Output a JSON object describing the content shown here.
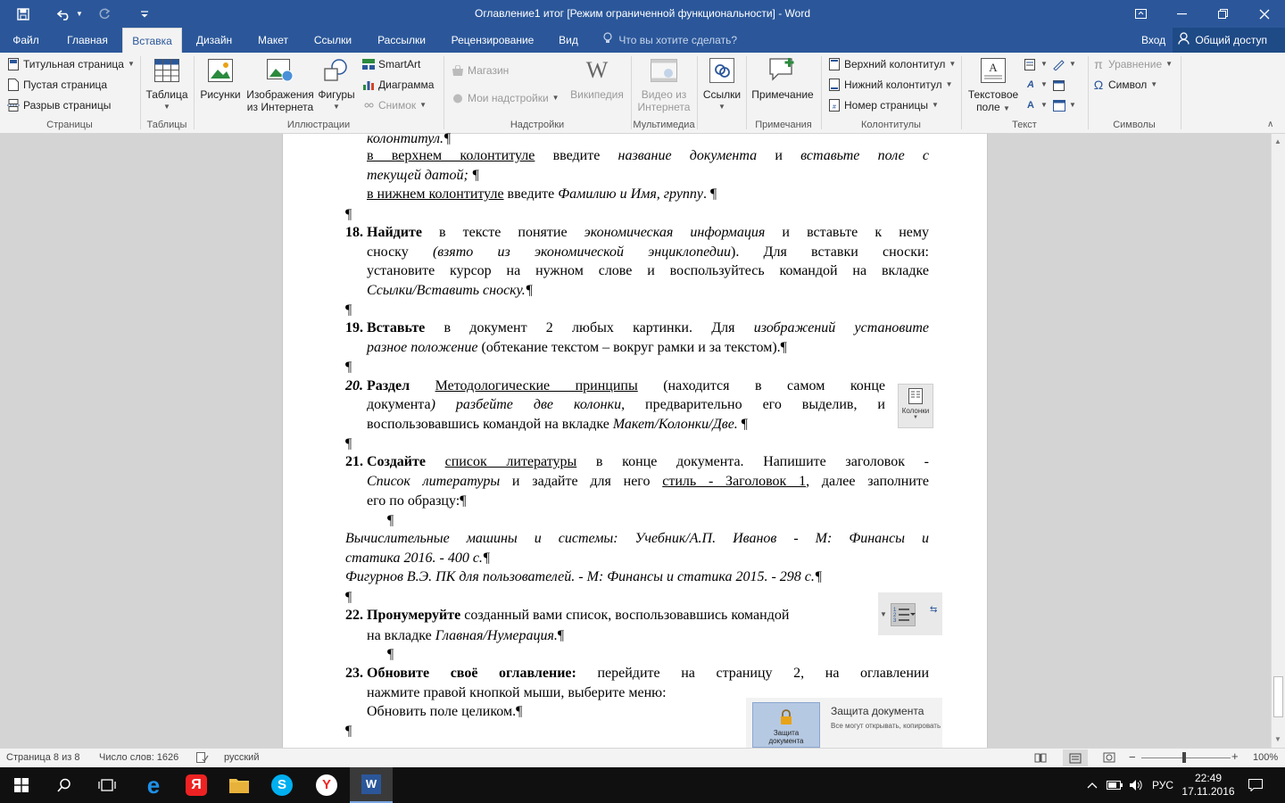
{
  "window": {
    "title": "Оглавление1 итог [Режим ограниченной функциональности] - Word"
  },
  "quick_access": {
    "save_icon": "save-icon",
    "undo_icon": "undo-icon",
    "redo_icon": "redo-icon",
    "customize_icon": "customize-qat-icon"
  },
  "tabs": [
    "Файл",
    "Главная",
    "Вставка",
    "Дизайн",
    "Макет",
    "Ссылки",
    "Рассылки",
    "Рецензирование",
    "Вид"
  ],
  "active_tab": "Вставка",
  "tell_me": "Что вы хотите сделать?",
  "signin": "Вход",
  "share": "Общий доступ",
  "ribbon": {
    "pages": {
      "items": [
        "Титульная страница",
        "Пустая страница",
        "Разрыв страницы"
      ],
      "label": "Страницы"
    },
    "tables": {
      "table": "Таблица",
      "label": "Таблицы"
    },
    "illustrations": {
      "pictures": "Рисунки",
      "online_1": "Изображения",
      "online_2": "из Интернета",
      "shapes": "Фигуры",
      "smartart": "SmartArt",
      "chart": "Диаграмма",
      "screenshot": "Снимок",
      "label": "Иллюстрации"
    },
    "addins": {
      "store": "Магазин",
      "my_addins": "Мои надстройки",
      "wikipedia": "Википедия",
      "label": "Надстройки"
    },
    "media": {
      "video_1": "Видео из",
      "video_2": "Интернета",
      "label": "Мультимедиа"
    },
    "links": {
      "links": "Ссылки",
      "label": ""
    },
    "comments": {
      "comment": "Примечание",
      "label": "Примечания"
    },
    "header_footer": {
      "header": "Верхний колонтитул",
      "footer": "Нижний колонтитул",
      "page_number": "Номер страницы",
      "label": "Колонтитулы"
    },
    "text": {
      "textbox_1": "Текстовое",
      "textbox_2": "поле",
      "label": "Текст"
    },
    "symbols": {
      "equation": "Уравнение",
      "symbol": "Символ",
      "label": "Символы"
    }
  },
  "document": {
    "l1": "колонтитул.¶",
    "l2a": "в верхнем колонтитуле",
    "l2b": " введите ",
    "l2c": "название документа",
    "l2d": " и ",
    "l2e": "вставьте поле с",
    "l3": "текущей датой; ¶",
    "l4a": "в нижнем колонтитуле",
    "l4b": " введите ",
    "l4c": "Фамилию и Имя, группу",
    "l4d": ". ¶",
    "pil": "¶",
    "n18": "18.",
    "i18a_b": "Найдите",
    "i18a_r": " в тексте понятие ",
    "i18a_i": "экономическая информация",
    "i18a_r2": " и вставьте к нему",
    "i18b_r": "сноску ",
    "i18b_i": "(взято из экономической энциклопедии",
    "i18b_r2": "). Для вставки сноски:",
    "i18c": "установите курсор на нужном слове и воспользуйтесь командой на вкладке",
    "i18d": "Ссылки/Вставить сноску.¶",
    "n19": "19.",
    "i19a_b": "Вставьте",
    "i19a_r": " в документ 2 любых картинки. Для ",
    "i19a_i": "изображений установите",
    "i19b_i": "разное положение",
    "i19b_r": " (обтекание текстом – вокруг рамки и за текстом).¶",
    "n20": "20.",
    "i20a_b": "Раздел",
    "i20a_u": "Методологические принципы",
    "i20a_r": " (находится в самом конце",
    "i20b_r": "документа",
    "i20b_i1": ") разбейте ",
    "i20b_i2": "две колонки",
    "i20b_r2": ", предварительно его выделив, и",
    "i20c_r": "воспользовавшись командой на вкладке ",
    "i20c_i": "Макет/Колонки/Две.",
    "i20c_end": " ¶",
    "columns_btn": "Колонки",
    "n21": "21.",
    "i21a_b": "Создайте",
    "i21a_u": "список литературы",
    "i21a_r": " в конце документа. Напишите заголовок -",
    "i21b_i": "Список литературы",
    "i21b_r": " и задайте для него ",
    "i21b_u": "стиль - Заголовок 1",
    "i21b_r2": ", далее заполните",
    "i21c": "его по образцу:¶",
    "ref1a": "Вычислительные машины и системы: Учебник/А.П. Иванов - М: Финансы и",
    "ref1b": "статика 2016. - 400 с.¶",
    "ref2": "Фигурнов В.Э. ПК для пользователей. - М: Финансы и статика 2015. - 298 с.¶",
    "n22": "22.",
    "i22a_b": "Пронумеруйте",
    "i22a_r": " созданный вами список, воспользовавшись командой",
    "i22b_r": "на вкладке ",
    "i22b_i": "Главная/Нумерация.",
    "i22b_end": "¶",
    "n23": "23.",
    "i23a_b": "Обновите своё оглавление:",
    "i23a_r": " перейдите на страницу 2, на оглавлении",
    "i23b": "нажмите правой кнопкой мыши, выберите меню:",
    "i23c": "Обновить поле целиком.¶",
    "protect_title": "Защита документа",
    "protect_desc": "Все могут открывать, копировать",
    "protect_btn_1": "Защита",
    "protect_btn_2": "документа"
  },
  "status": {
    "page": "Страница 8 из 8",
    "words": "Число слов: 1626",
    "language": "русский",
    "zoom": "100%"
  },
  "taskbar": {
    "lang": "РУС",
    "time": "22:49",
    "date": "17.11.2016"
  },
  "colors": {
    "accent": "#2b579a",
    "ribbon_bg": "#f3f3f3",
    "doc_bg": "#d4d4d4",
    "taskbar": "#101010"
  }
}
